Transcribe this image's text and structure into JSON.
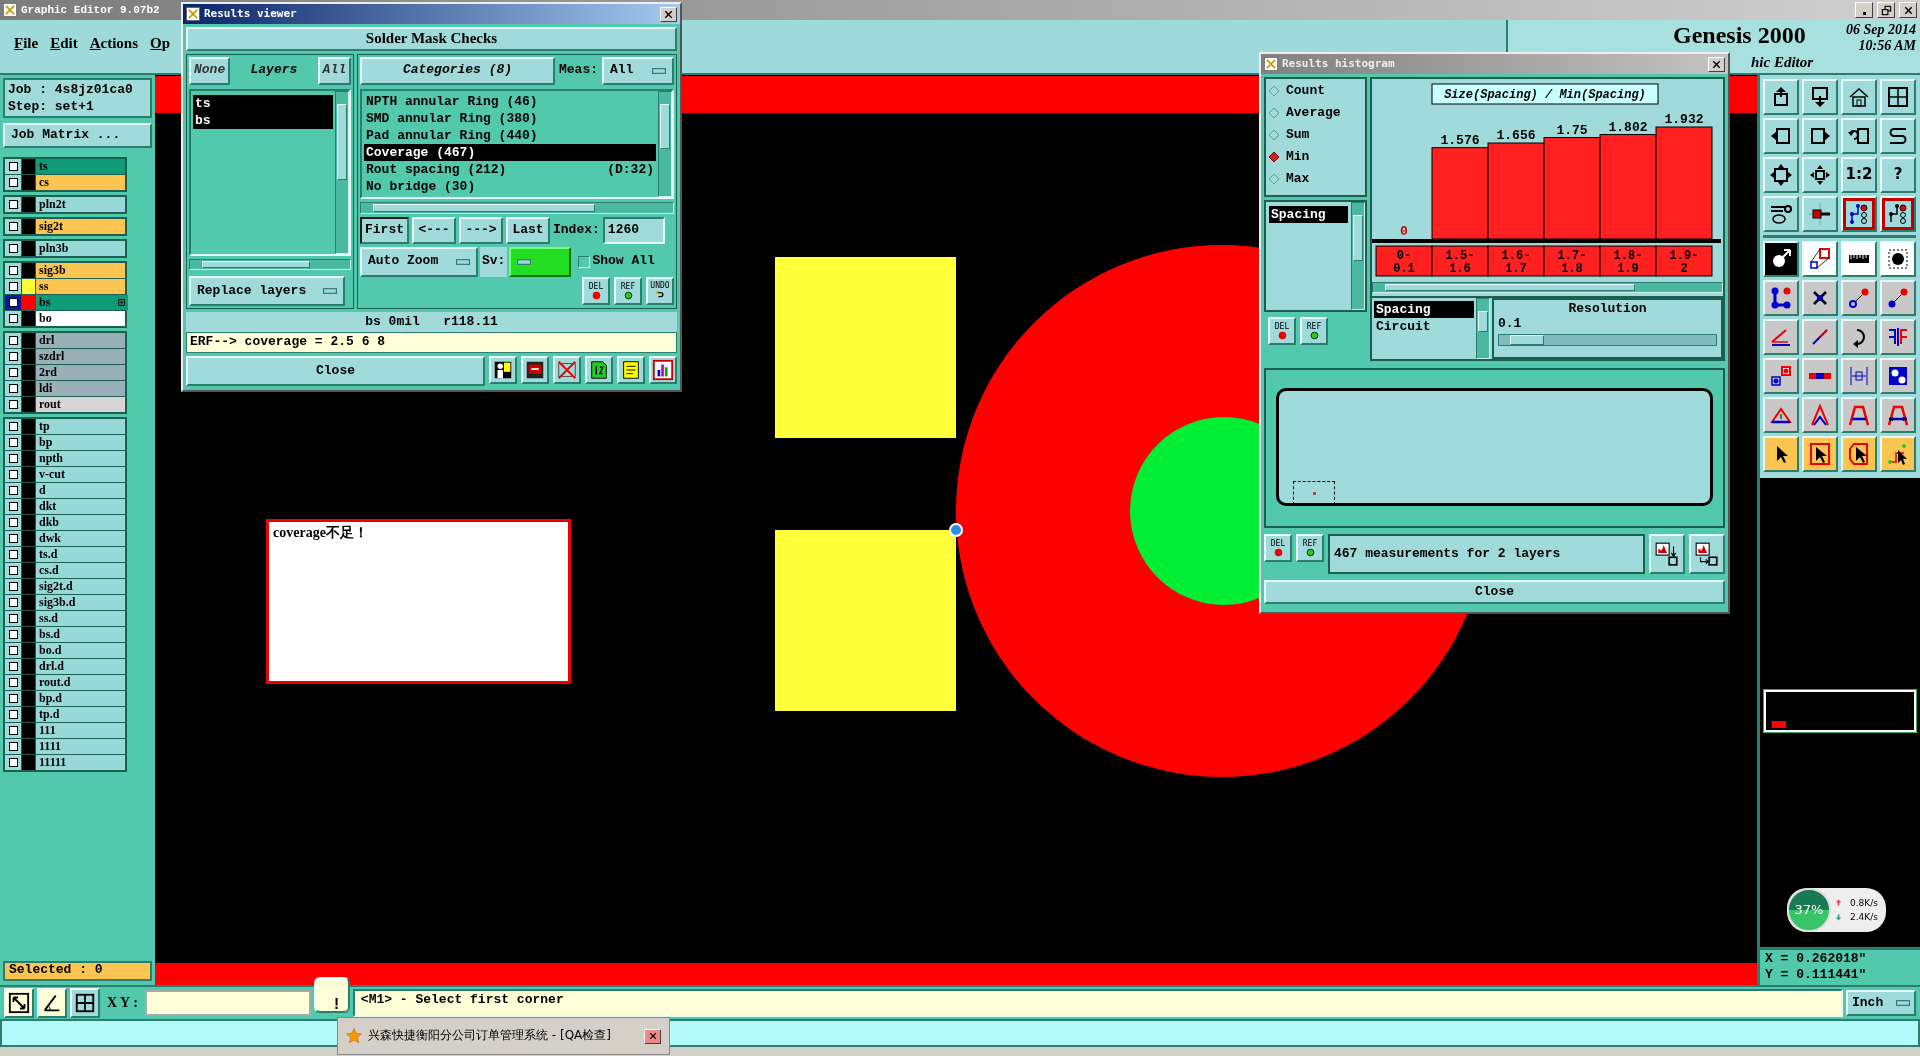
{
  "app": {
    "title": "Graphic Editor 9.07b2",
    "menus": [
      "File",
      "Edit",
      "Actions",
      "Op"
    ],
    "product": "Genesis 2000",
    "subtitle": "hic Editor",
    "date": "06 Sep 2014",
    "time": "10:56 AM"
  },
  "left_panel": {
    "job": "Job : 4s8jz01ca0",
    "step": "Step: set+1",
    "job_matrix": "Job Matrix ...",
    "layer_groups": [
      {
        "layers": [
          {
            "name": "ts",
            "kind": "mask",
            "color": "#000000",
            "selected": false
          },
          {
            "name": "cs",
            "kind": "signal",
            "color": "#000000",
            "selected": false
          }
        ]
      },
      {
        "layers": [
          {
            "name": "pln2t",
            "kind": "plane",
            "color": "#000000",
            "selected": false
          }
        ]
      },
      {
        "layers": [
          {
            "name": "sig2t",
            "kind": "signal",
            "color": "#000000",
            "selected": false
          }
        ]
      },
      {
        "layers": [
          {
            "name": "pln3b",
            "kind": "plane",
            "color": "#000000",
            "selected": false
          }
        ]
      },
      {
        "layers": [
          {
            "name": "sig3b",
            "kind": "signal",
            "color": "#000000",
            "selected": false
          },
          {
            "name": "ss",
            "kind": "signal",
            "color": "#ffff33",
            "selected": false
          },
          {
            "name": "bs",
            "kind": "mask",
            "color": "#ff0000",
            "selected": true
          },
          {
            "name": "bo",
            "kind": "outline",
            "color": "#000000",
            "selected": false
          }
        ]
      },
      {
        "layers": [
          {
            "name": "drl",
            "kind": "drill",
            "color": "#000000",
            "selected": false
          },
          {
            "name": "szdrl",
            "kind": "drill",
            "color": "#000000",
            "selected": false
          },
          {
            "name": "2rd",
            "kind": "drill",
            "color": "#000000",
            "selected": false
          },
          {
            "name": "ldi",
            "kind": "drill",
            "color": "#000000",
            "selected": false
          },
          {
            "name": "rout",
            "kind": "rout",
            "color": "#000000",
            "selected": false
          }
        ]
      },
      {
        "layers": [
          {
            "name": "tp",
            "kind": "misc",
            "color": "#000000",
            "selected": false
          },
          {
            "name": "bp",
            "kind": "misc",
            "color": "#000000",
            "selected": false
          },
          {
            "name": "npth",
            "kind": "misc",
            "color": "#000000",
            "selected": false
          },
          {
            "name": "v-cut",
            "kind": "misc",
            "color": "#000000",
            "selected": false
          },
          {
            "name": "d",
            "kind": "misc",
            "color": "#000000",
            "selected": false
          },
          {
            "name": "dkt",
            "kind": "misc",
            "color": "#000000",
            "selected": false
          },
          {
            "name": "dkb",
            "kind": "misc",
            "color": "#000000",
            "selected": false
          },
          {
            "name": "dwk",
            "kind": "misc",
            "color": "#000000",
            "selected": false
          },
          {
            "name": "ts.d",
            "kind": "misc",
            "color": "#000000",
            "selected": false
          },
          {
            "name": "cs.d",
            "kind": "misc",
            "color": "#000000",
            "selected": false
          },
          {
            "name": "sig2t.d",
            "kind": "misc",
            "color": "#000000",
            "selected": false
          },
          {
            "name": "sig3b.d",
            "kind": "misc",
            "color": "#000000",
            "selected": false
          },
          {
            "name": "ss.d",
            "kind": "misc",
            "color": "#000000",
            "selected": false
          },
          {
            "name": "bs.d",
            "kind": "misc",
            "color": "#000000",
            "selected": false
          },
          {
            "name": "bo.d",
            "kind": "misc",
            "color": "#000000",
            "selected": false
          },
          {
            "name": "drl.d",
            "kind": "misc",
            "color": "#000000",
            "selected": false
          },
          {
            "name": "rout.d",
            "kind": "misc",
            "color": "#000000",
            "selected": false
          },
          {
            "name": "bp.d",
            "kind": "misc",
            "color": "#000000",
            "selected": false
          },
          {
            "name": "tp.d",
            "kind": "misc",
            "color": "#000000",
            "selected": false
          },
          {
            "name": "111",
            "kind": "misc",
            "color": "#000000",
            "selected": false
          },
          {
            "name": "1111",
            "kind": "misc",
            "color": "#000000",
            "selected": false
          },
          {
            "name": "11111",
            "kind": "misc",
            "color": "#000000",
            "selected": false
          }
        ]
      }
    ],
    "selected_count": "Selected : 0"
  },
  "canvas": {
    "note": "coverage不足！"
  },
  "results_viewer": {
    "title": "Results viewer",
    "heading": "Solder Mask Checks",
    "layer_tabs": [
      {
        "label": "None",
        "selected": false
      },
      {
        "label": "Layers",
        "selected": true
      },
      {
        "label": "All",
        "selected": false
      }
    ],
    "layers": [
      {
        "name": "ts",
        "selected": true
      },
      {
        "name": "bs",
        "selected": true
      }
    ],
    "replace": "Replace layers",
    "categories_label": "Categories (8)",
    "meas_label": "Meas:",
    "meas_value": "All",
    "categories": [
      {
        "name": "NPTH annular Ring (46)",
        "selected": false
      },
      {
        "name": "SMD annular Ring (380)",
        "selected": false
      },
      {
        "name": "Pad annular Ring (440)",
        "selected": false
      },
      {
        "name": "Coverage (467)",
        "selected": true
      },
      {
        "name": "Rout spacing (212)",
        "note": "(D:32)",
        "selected": false
      },
      {
        "name": "No bridge (30)",
        "selected": false
      }
    ],
    "nav_buttons": [
      {
        "label": "First",
        "selected": true
      },
      {
        "label": "<---",
        "selected": false
      },
      {
        "label": "--->",
        "selected": false
      },
      {
        "label": "Last",
        "selected": false
      }
    ],
    "index_label": "Index:",
    "index_value": "1260",
    "auto_zoom": "Auto Zoom",
    "sv_label": "Sv:",
    "show_all": {
      "label": "Show All",
      "checked": false
    },
    "action_buttons": [
      {
        "label": "DEL",
        "kind": "del"
      },
      {
        "label": "REF",
        "kind": "ref"
      },
      {
        "label": "UNDO",
        "kind": "undo"
      }
    ],
    "info": "bs 0mil   r118.11",
    "erf": "ERF--> coverage = 2.5 6 8",
    "close": "Close"
  },
  "histogram": {
    "title": "Results histogram",
    "modes": [
      {
        "label": "Count",
        "selected": false
      },
      {
        "label": "Average",
        "selected": false
      },
      {
        "label": "Sum",
        "selected": false
      },
      {
        "label": "Min",
        "selected": true
      },
      {
        "label": "Max",
        "selected": false
      }
    ],
    "measures": [
      {
        "label": "Spacing",
        "selected": true
      }
    ],
    "list_buttons": [
      {
        "label": "DEL",
        "kind": "del"
      },
      {
        "label": "REF",
        "kind": "ref"
      }
    ],
    "chart_data": {
      "type": "bar",
      "title": "Size(Spacing) / Min(Spacing)",
      "categories": [
        "0-0.1",
        "1.5-1.6",
        "1.6-1.7",
        "1.7-1.8",
        "1.8-1.9",
        "1.9-2"
      ],
      "series": [
        {
          "color": "#ff2020",
          "values": [
            0,
            1.576,
            1.656,
            1.75,
            1.802,
            1.932
          ]
        }
      ],
      "data_labels": true
    },
    "types": [
      {
        "label": "Spacing",
        "selected": true
      },
      {
        "label": "Circuit",
        "selected": false
      }
    ],
    "resolution_label": "Resolution",
    "resolution_value": "0.1",
    "resolution": {
      "level": 0.06
    },
    "bottom_buttons": [
      {
        "label": "DEL",
        "kind": "del"
      },
      {
        "label": "REF",
        "kind": "ref"
      }
    ],
    "summary": "467 measurements for 2 layers",
    "close": "Close"
  },
  "toolbar": {
    "ratio_label": "1:2",
    "help_label": "?"
  },
  "network_monitor": {
    "percent": "37%",
    "upload": "0.8K/s",
    "download": "2.4K/s"
  },
  "coordinates": {
    "x": "X = 0.262018\"",
    "y": "Y = 0.111441\""
  },
  "command_bar": {
    "xy_label": "X Y :",
    "alert": "!",
    "message": "<M1> - Select first corner",
    "units": "Inch"
  },
  "taskbar_popup": {
    "text": "兴森快捷衡阳分公司订单管理系统 - [QA检查]"
  }
}
